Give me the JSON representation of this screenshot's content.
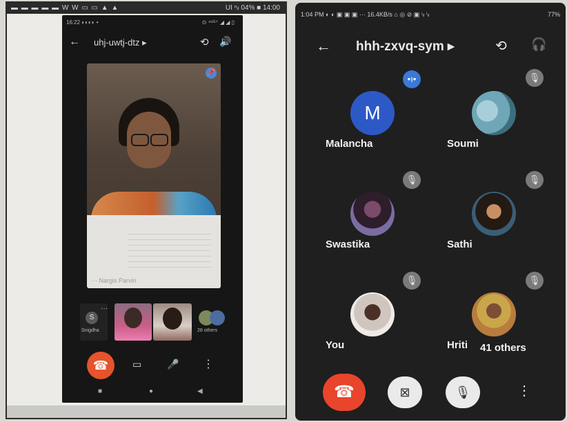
{
  "left": {
    "topstrip": {
      "left": "▬ ▬ ▬ ▬ ▬ W W ▭ ▭ ▲ ▲",
      "right": "UI ⁿᵢₗ 04% ■ 14:00"
    },
    "status": {
      "left": "16:22 ◐◐◐◐ •",
      "right": "⊙ ⁴⁶ᴳ⁺ ◢ ◢ ▯"
    },
    "appbar": {
      "back": "←",
      "title": "uhj-uwtj-dtz ▸",
      "switch_icon": "⟲",
      "speaker_icon": "🔊"
    },
    "main_video": {
      "pin_icon": "📌",
      "name": "··· Nargis Parvin"
    },
    "thumbs": {
      "snigdha_initial": "S",
      "snigdha_label": "Snigdha",
      "dots": "···",
      "others_label": "28 others"
    },
    "controls": {
      "end_icon": "☎",
      "camera_icon": "▭",
      "mic_icon": "🎤",
      "more_icon": "⋮"
    },
    "nav": {
      "recents": "■",
      "home": "●",
      "back": "◀"
    }
  },
  "right": {
    "status": {
      "left": "1:04 PM ◐ ◐ ▣ ▣ ▣ ··· 16.4KB/s ⌂ ◎ ⊘ ▣ ⁱₗₗ ⁱₗₗ",
      "right": "77%"
    },
    "appbar": {
      "back": "←",
      "title": "hhh-zxvq-sym ▸",
      "switch_icon": "⟲",
      "headset_icon": "🎧"
    },
    "participants": [
      {
        "name": "Malancha",
        "initial": "M",
        "badge": "•ı•"
      },
      {
        "name": "Soumi",
        "badge": "🎙"
      },
      {
        "name": "Swastika",
        "badge": "🎙"
      },
      {
        "name": "Sathi",
        "badge": "🎙"
      },
      {
        "name": "You",
        "badge": "🎙"
      },
      {
        "name": "Hriti",
        "badge": "🎙"
      }
    ],
    "others_label": "41 others",
    "controls": {
      "end_icon": "☎",
      "camera_icon": "⊠",
      "mic_icon": "🎙",
      "more_icon": "⋮"
    }
  },
  "colors": {
    "end_call": "#e8452c",
    "accent_blue": "#2d59c7",
    "dark_bg": "#1f1f1f"
  }
}
